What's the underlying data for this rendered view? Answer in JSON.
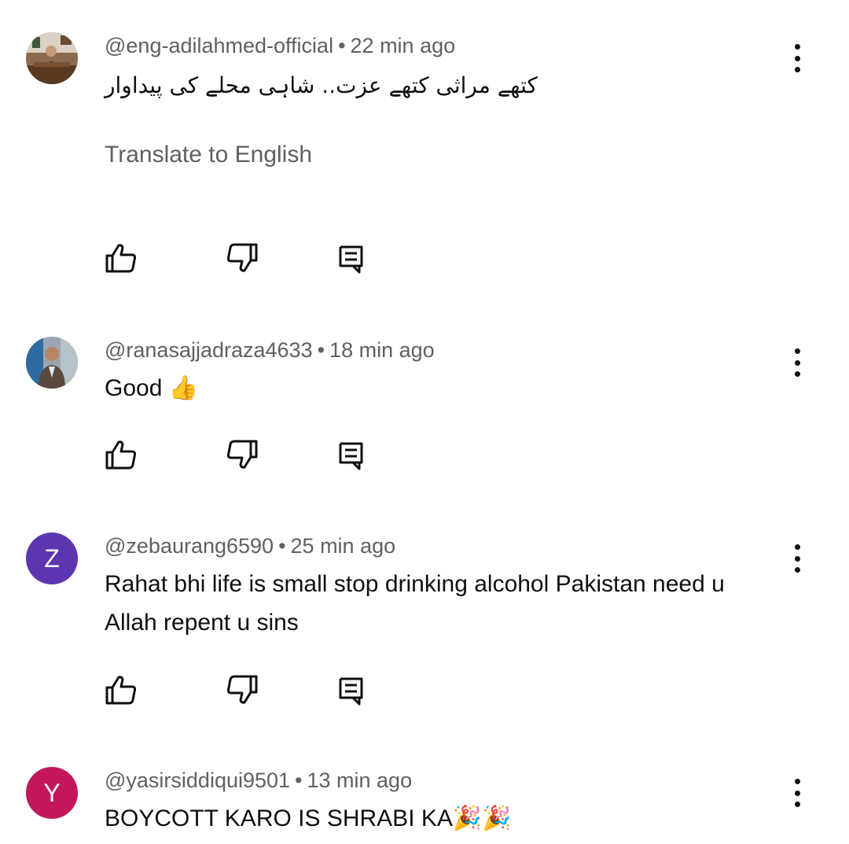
{
  "comments": [
    {
      "handle": "@eng-adilahmed-official",
      "separator": "•",
      "time": "22 min ago",
      "text": "کتھے مراثی کتھے عزت.. شاہی محلے کی پیداوار",
      "translate_label": "Translate to English",
      "avatar_icon": "profile-photo"
    },
    {
      "handle": "@ranasajjadraza4633",
      "separator": "•",
      "time": "18 min ago",
      "text": "Good 👍",
      "avatar_icon": "profile-photo"
    },
    {
      "handle": "@zebaurang6590",
      "separator": "•",
      "time": "25 min ago",
      "text": "Rahat bhi  life is small stop drinking alcohol Pakistan need u  Allah repent u sins",
      "avatar_letter": "Z",
      "avatar_color": "#5e35b1"
    },
    {
      "handle": "@yasirsiddiqui9501",
      "separator": "•",
      "time": "13 min ago",
      "text": "BOYCOTT KARO IS SHRABI KA🎉🎉",
      "avatar_letter": "Y",
      "avatar_color": "#c2185b"
    }
  ],
  "icons": {
    "like": "thumb-up-icon",
    "dislike": "thumb-down-icon",
    "reply": "reply-comment-icon",
    "more": "more-vertical-icon"
  },
  "colors": {
    "meta_text": "#606060",
    "body_text": "#0f0f0f"
  }
}
